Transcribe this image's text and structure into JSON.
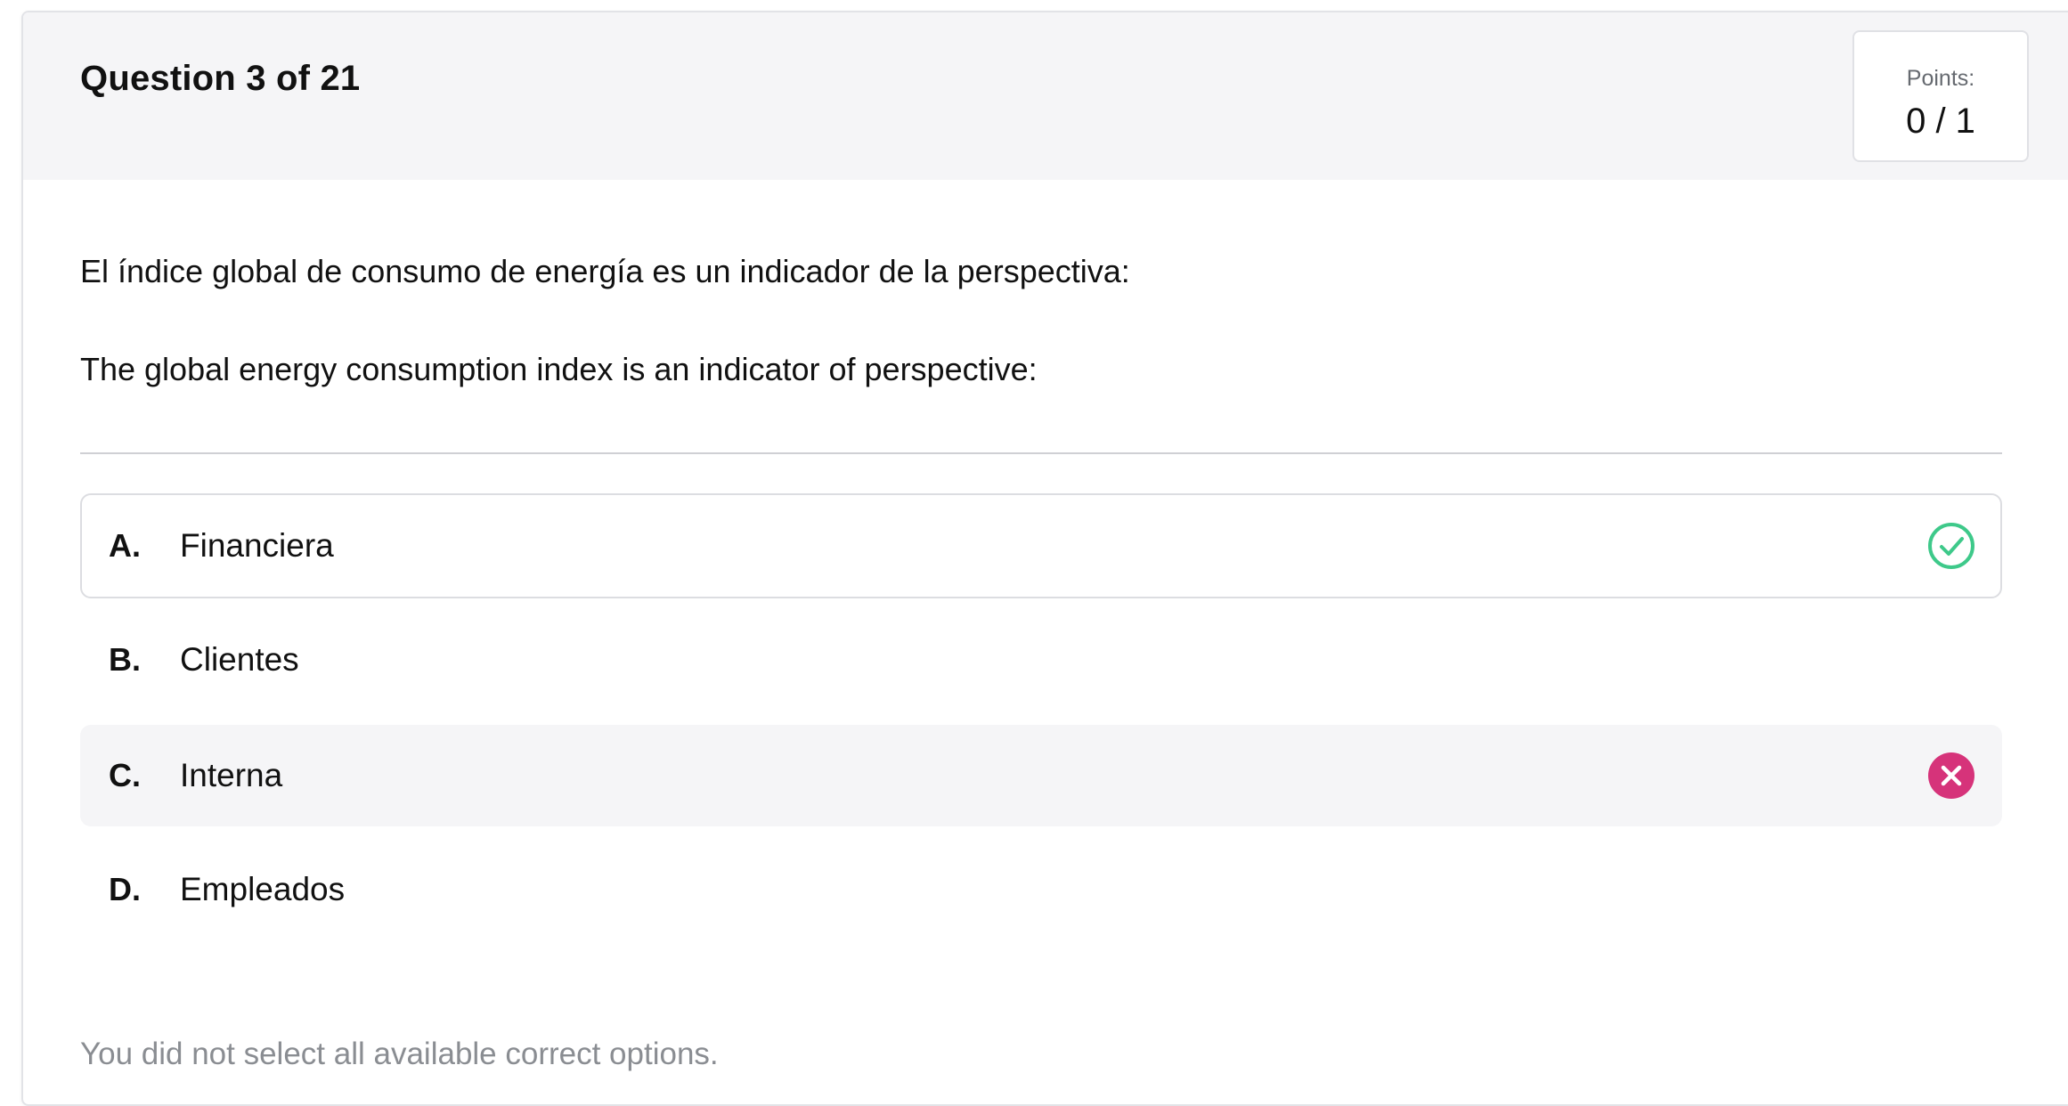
{
  "header": {
    "question_title": "Question 3 of 21",
    "points_label": "Points:",
    "points_value": "0 / 1"
  },
  "question": {
    "prompt_es": "El índice global de consumo de energía es un indicador de la perspectiva:",
    "prompt_en": "The global energy consumption index is an indicator of perspective:"
  },
  "options": [
    {
      "letter": "A.",
      "text": "Financiera",
      "status": "correct",
      "icon": "check-circle-icon"
    },
    {
      "letter": "B.",
      "text": "Clientes",
      "status": "none"
    },
    {
      "letter": "C.",
      "text": "Interna",
      "status": "incorrect-selected",
      "icon": "x-circle-icon"
    },
    {
      "letter": "D.",
      "text": "Empleados",
      "status": "none"
    }
  ],
  "feedback": "You did not select all available correct options.",
  "colors": {
    "correct": "#3ec98a",
    "incorrect": "#d6337a",
    "header_bg": "#f5f5f7",
    "muted_text": "#8a8d92"
  }
}
